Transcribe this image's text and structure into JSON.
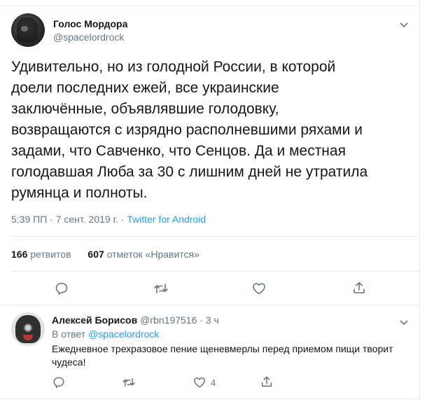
{
  "tweet": {
    "author_name": "Голос Мордора",
    "author_handle": "@spacelordrock",
    "text": "Удивительно, но из голодной России, в которой\nдоели последних ежей, все украинские\nзаключённые, объявлявшие голодовку,\nвозвращаются с изрядно располневшими ряхами и\nзадами, что Савченко, что Сенцов. Да и местная\nголодавшая Люба за 30 с лишним дней не утратила\nрумянца и полноты.",
    "timestamp": "5:39 ПП · 7 сент. 2019 г. · ",
    "source": "Twitter for Android",
    "retweets_count": "166",
    "retweets_label": "ретвитов",
    "likes_count": "607",
    "likes_label": "отметок «Нравится»"
  },
  "reply": {
    "author_name": "Алексей Борисов",
    "author_handle": "@rbn197516",
    "time": " · 3 ч",
    "reply_to_label": "В ответ ",
    "reply_to_handle": "@spacelordrock",
    "text": "Ежедневное трехразовое пение щеневмерлы перед приемом пищи творит чудеса!",
    "like_count": "4"
  },
  "colors": {
    "accent": "#1da1f2",
    "secondary_text": "#657786",
    "divider": "#e6ecf0"
  },
  "icons": [
    "chevron-down-icon",
    "reply-icon",
    "retweet-icon",
    "like-icon",
    "share-icon"
  ]
}
